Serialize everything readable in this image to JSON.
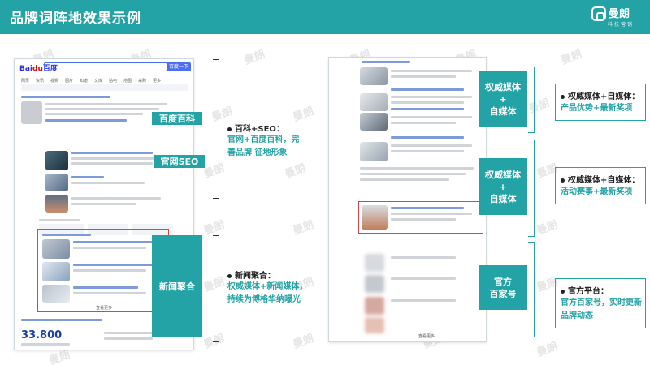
{
  "header": {
    "title": "品牌词阵地效果示例"
  },
  "brand": {
    "name": "曼朗",
    "sub": "科技营销"
  },
  "watermark": "曼朗",
  "shot1": {
    "search_button": "百度一下",
    "tabs": [
      "网页",
      "资讯",
      "视频",
      "图片",
      "知道",
      "文库",
      "贴吧",
      "地图",
      "采购",
      "更多"
    ],
    "page_link": "查看更多",
    "price": "33.800"
  },
  "shot2": {
    "page_link": "查看更多"
  },
  "tags": {
    "baike": "百度百科",
    "seo": "官网SEO",
    "news": "新闻聚合"
  },
  "notes": [
    {
      "label": "百科+SEO：",
      "desc": [
        "官网+百度百科，完",
        "善品牌 征地形象"
      ]
    },
    {
      "label": "新闻聚合：",
      "desc": [
        "权威媒体+新闻媒体，",
        "持续为博格华纳曝光"
      ]
    }
  ],
  "rtags": [
    {
      "lines": [
        "权威媒体",
        "+",
        "自媒体"
      ]
    },
    {
      "lines": [
        "权威媒体",
        "+",
        "自媒体"
      ]
    },
    {
      "lines": [
        "官方",
        "百家号"
      ]
    }
  ],
  "rnotes": [
    {
      "label": "权威媒体+自媒体：",
      "desc": [
        "产品优势+最新奖项"
      ]
    },
    {
      "label": "权威媒体+自媒体：",
      "desc": [
        "活动赛事+最新奖项"
      ]
    },
    {
      "label": "官方平台：",
      "desc": [
        "官方百家号，实时更新",
        "品牌动态"
      ]
    }
  ],
  "colors": {
    "accent": "#23a3a5",
    "highlight": "#e2413e",
    "baidu_blue": "#4e6ef2"
  }
}
